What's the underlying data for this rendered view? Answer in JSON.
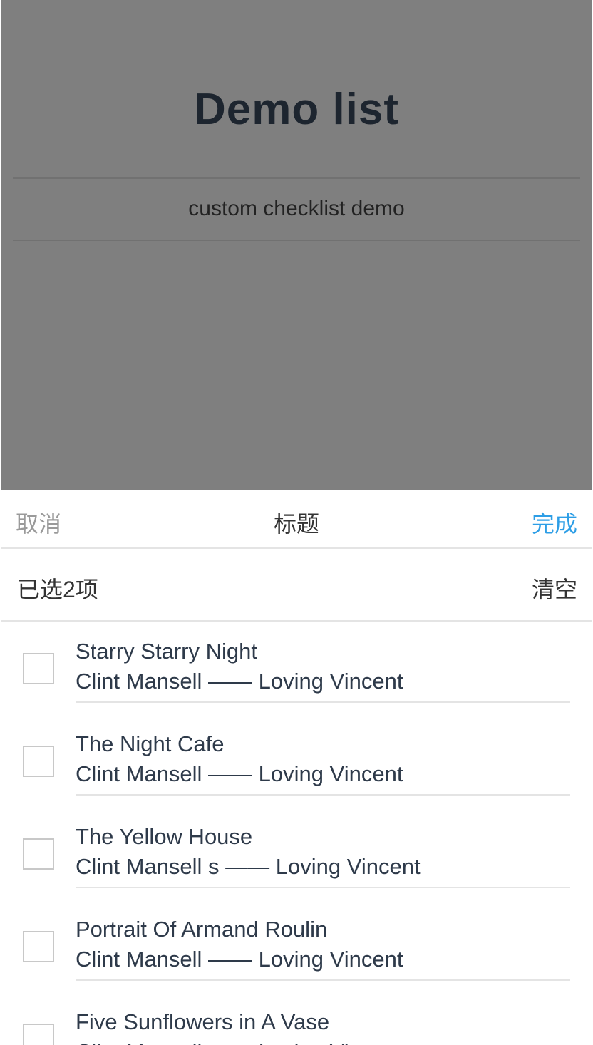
{
  "background_page": {
    "title": "Demo list",
    "subtitle": "custom checklist demo"
  },
  "sheet": {
    "header": {
      "cancel_label": "取消",
      "title": "标题",
      "done_label": "完成",
      "done_color": "#2d9ee6"
    },
    "summary": {
      "selected_text": "已选2项",
      "clear_label": "清空"
    },
    "items": [
      {
        "title": "Starry Starry Night",
        "subtitle": "Clint Mansell —— Loving Vincent",
        "checked": false
      },
      {
        "title": "The Night Cafe",
        "subtitle": "Clint Mansell —— Loving Vincent",
        "checked": false
      },
      {
        "title": "The Yellow House",
        "subtitle": "Clint Mansell s —— Loving Vincent",
        "checked": false
      },
      {
        "title": "Portrait Of Armand Roulin",
        "subtitle": "Clint Mansell —— Loving Vincent",
        "checked": false
      },
      {
        "title": "Five Sunflowers in A Vase",
        "subtitle": "Clint Mansell —— Loving Vincent",
        "checked": false
      }
    ]
  },
  "colors": {
    "overlay": "rgba(0,0,0,0.5)",
    "accent": "#2d9ee6"
  }
}
